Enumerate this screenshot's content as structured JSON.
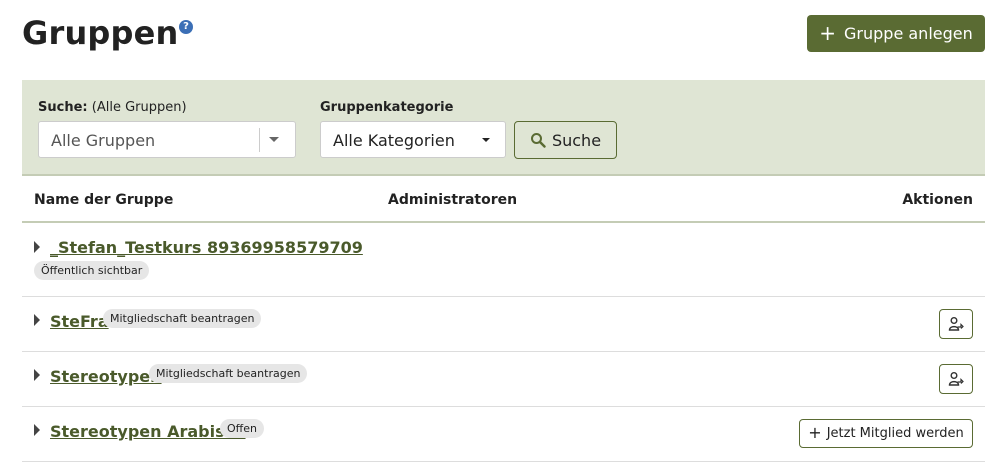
{
  "page": {
    "title": "Gruppen",
    "help_icon": "?",
    "create_button_label": "Gruppe anlegen"
  },
  "search": {
    "label_bold": "Suche:",
    "label_hint": "(Alle Gruppen)",
    "value": "Alle Gruppen",
    "category_label": "Gruppenkategorie",
    "category_value": "Alle Kategorien",
    "button_label": "Suche"
  },
  "table": {
    "headers": {
      "name": "Name der Gruppe",
      "admins": "Administratoren",
      "actions": "Aktionen"
    },
    "rows": [
      {
        "name": "_Stefan_Testkurs 89369958579709",
        "badge": "Öffentlich sichtbar",
        "action": ""
      },
      {
        "name": "SteFra",
        "badge": "Mitgliedschaft beantragen",
        "action": "request-membership-icon"
      },
      {
        "name": "Stereotypen",
        "badge": "Mitgliedschaft beantragen",
        "action": "request-membership-icon"
      },
      {
        "name": "Stereotypen Arabisch",
        "badge": "Offen",
        "action": "Jetzt Mitglied werden"
      }
    ]
  },
  "colors": {
    "primary": "#5a6b33",
    "panel_bg": "#dfe5d4",
    "link": "#4a5a2b",
    "help": "#3b6fb6"
  }
}
